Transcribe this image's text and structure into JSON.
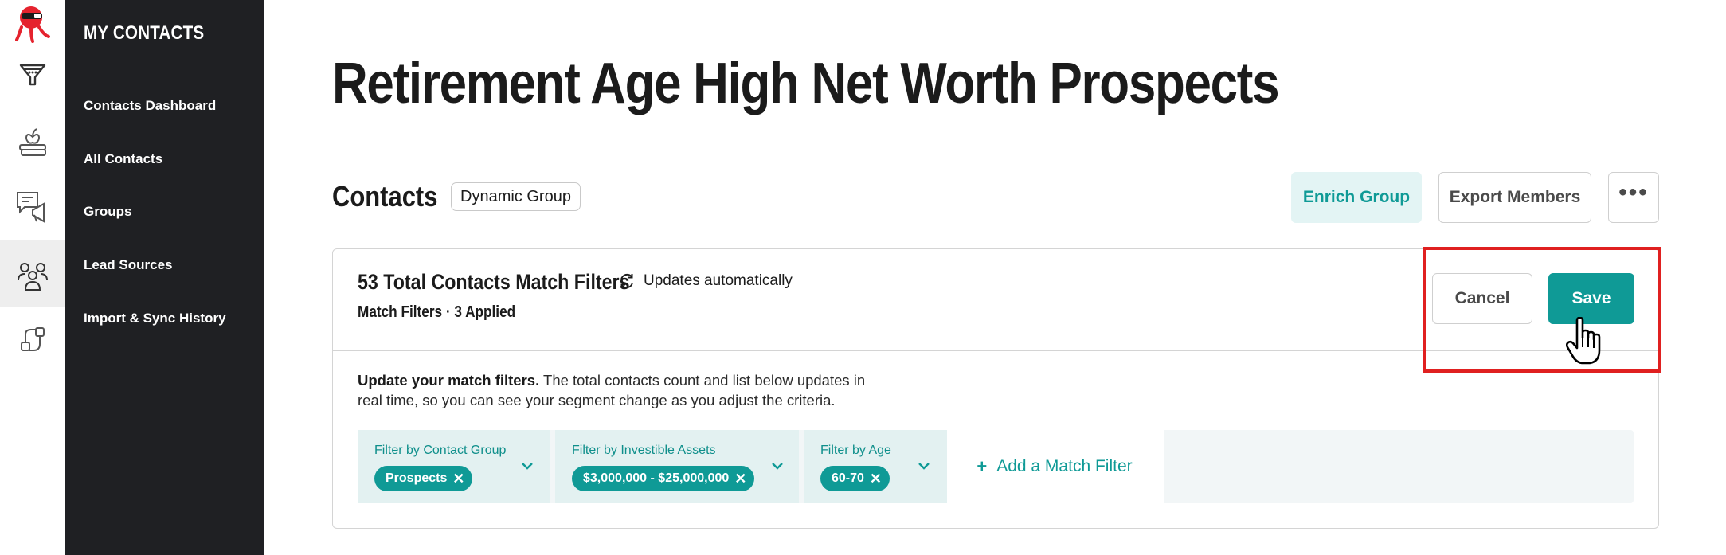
{
  "rail": {
    "items": [
      {
        "icon": "ninja-logo-icon"
      },
      {
        "icon": "funnel-icon"
      },
      {
        "icon": "apple-books-icon"
      },
      {
        "icon": "chat-megaphone-icon"
      },
      {
        "icon": "contacts-people-icon",
        "active": true
      },
      {
        "icon": "plug-integrations-icon"
      }
    ]
  },
  "sidebar": {
    "title": "MY CONTACTS",
    "items": [
      {
        "label": "Contacts Dashboard"
      },
      {
        "label": "All Contacts"
      },
      {
        "label": "Groups"
      },
      {
        "label": "Lead Sources"
      },
      {
        "label": "Import & Sync History"
      }
    ]
  },
  "page": {
    "title": "Retirement Age High Net Worth Prospects"
  },
  "section": {
    "title": "Contacts",
    "badge": "Dynamic Group",
    "enrich_label": "Enrich Group",
    "export_label": "Export Members",
    "more_label": "•••"
  },
  "card": {
    "title": "53 Total Contacts Match Filters",
    "updates_label": "Updates automatically",
    "subtitle": "Match Filters · 3 Applied",
    "cancel_label": "Cancel",
    "save_label": "Save",
    "desc_bold": "Update your match filters.",
    "desc_rest": " The total contacts count and list below updates in real time, so you can see your segment change as you adjust the criteria."
  },
  "filters": [
    {
      "label": "Filter by Contact Group",
      "chip": "Prospects"
    },
    {
      "label": "Filter by Investible Assets",
      "chip": "$3,000,000 - $25,000,000"
    },
    {
      "label": "Filter by Age",
      "chip": "60-70"
    }
  ],
  "add_filter": {
    "plus": "+",
    "label": "Add a Match Filter"
  },
  "colors": {
    "accent": "#0f9a96",
    "accent_light": "#e3f4f4",
    "sidebar_bg": "#1f2023",
    "highlight": "#e02020"
  }
}
